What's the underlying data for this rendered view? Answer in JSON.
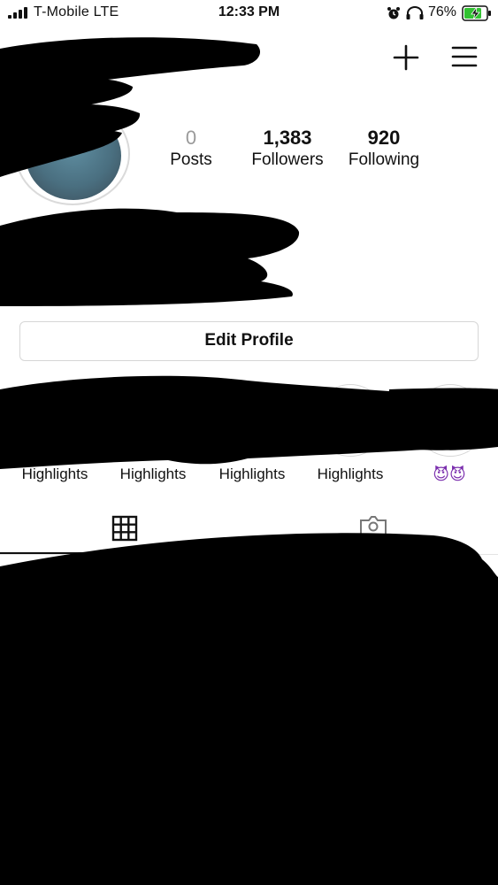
{
  "status_bar": {
    "carrier": "T-Mobile  LTE",
    "time": "12:33 PM",
    "battery_percent": "76%"
  },
  "header": {
    "icons": [
      "plus-icon",
      "menu-icon"
    ]
  },
  "profile": {
    "stats": {
      "posts": {
        "count": "0",
        "label": "Posts"
      },
      "followers": {
        "count": "1,383",
        "label": "Followers"
      },
      "following": {
        "count": "920",
        "label": "Following"
      }
    },
    "edit_profile_label": "Edit Profile"
  },
  "highlights": [
    {
      "label": "Highlights"
    },
    {
      "label": "Highlights"
    },
    {
      "label": "Highlights"
    },
    {
      "label": "Highlights"
    },
    {
      "label": "😈😈"
    }
  ],
  "tabs": {
    "active": "grid",
    "icons": [
      "grid-icon",
      "tagged-icon"
    ]
  },
  "colors": {
    "text": "#111111",
    "muted": "#9a9a9a",
    "border": "#d6d6d6",
    "battery_green": "#32c232",
    "redaction": "#000000"
  }
}
